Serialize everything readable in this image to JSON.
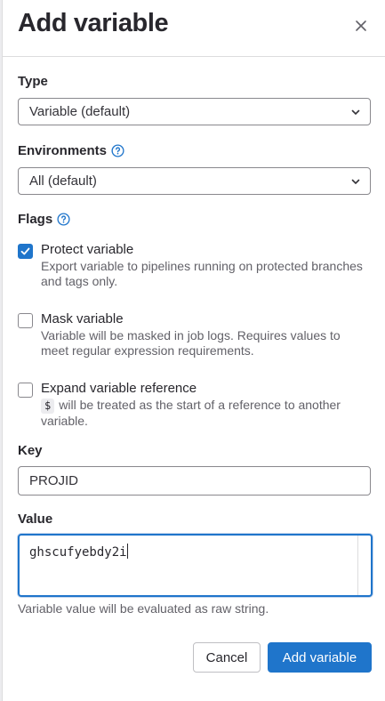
{
  "drawer": {
    "title": "Add variable"
  },
  "type": {
    "label": "Type",
    "selected": "Variable (default)"
  },
  "environments": {
    "label": "Environments",
    "selected": "All (default)"
  },
  "flags": {
    "label": "Flags",
    "protect": {
      "label": "Protect variable",
      "checked": true,
      "help": "Export variable to pipelines running on protected branches and tags only."
    },
    "mask": {
      "label": "Mask variable",
      "checked": false,
      "help": "Variable will be masked in job logs. Requires values to meet regular expression requirements."
    },
    "expand": {
      "label": "Expand variable reference",
      "checked": false,
      "code": "$",
      "help": "will be treated as the start of a reference to another variable."
    }
  },
  "key": {
    "label": "Key",
    "value": "PROJID"
  },
  "value": {
    "label": "Value",
    "value": "ghscufyebdy2i",
    "hint": "Variable value will be evaluated as raw string."
  },
  "actions": {
    "cancel": "Cancel",
    "submit": "Add variable"
  },
  "colors": {
    "accent": "#1f75cb",
    "text": "#28272d",
    "muted": "#626168",
    "border": "#89888d"
  }
}
